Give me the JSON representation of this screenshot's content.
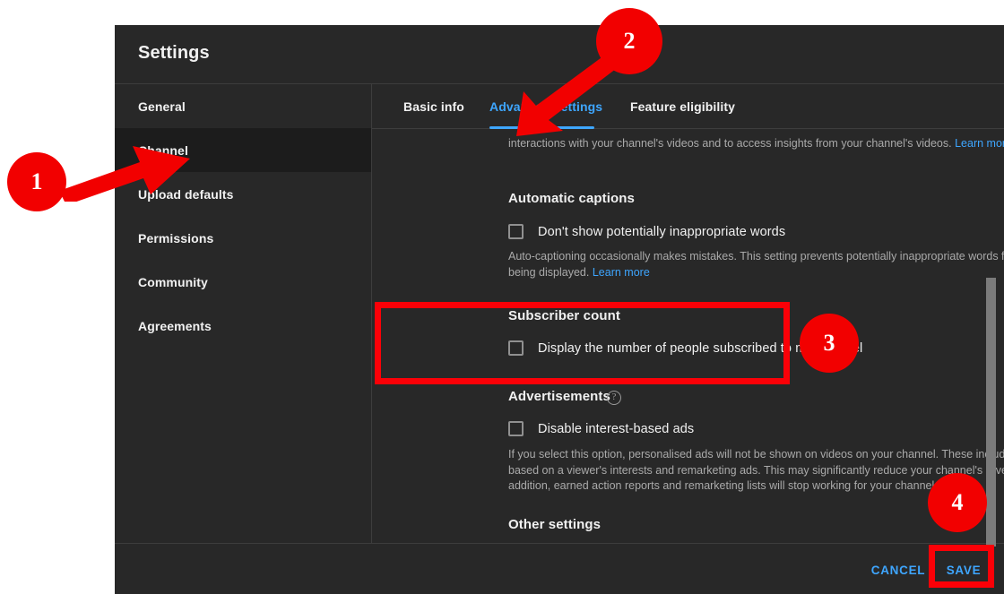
{
  "dialog": {
    "title": "Settings"
  },
  "sidebar": {
    "items": [
      {
        "label": "General",
        "active": false
      },
      {
        "label": "Channel",
        "active": true
      },
      {
        "label": "Upload defaults",
        "active": false
      },
      {
        "label": "Permissions",
        "active": false
      },
      {
        "label": "Community",
        "active": false
      },
      {
        "label": "Agreements",
        "active": false
      }
    ]
  },
  "tabs": [
    {
      "label": "Basic info",
      "active": false
    },
    {
      "label": "Advanced settings",
      "active": true
    },
    {
      "label": "Feature eligibility",
      "active": false
    }
  ],
  "content": {
    "clipped_paragraph": "interactions with your channel's videos and to access insights from your channel's videos.",
    "clipped_paragraph_link": "Learn more",
    "sections": [
      {
        "title": "Automatic captions",
        "checkbox_label": "Don't show potentially inappropriate words",
        "checked": false,
        "helper": "Auto-captioning occasionally makes mistakes. This setting prevents potentially inappropriate words from being displayed.",
        "helper_link": "Learn more"
      },
      {
        "title": "Subscriber count",
        "checkbox_label": "Display the number of people subscribed to my channel",
        "checked": false,
        "helper": "",
        "helper_link": ""
      },
      {
        "title": "Advertisements",
        "help_icon": "question-mark-circle-icon",
        "checkbox_label": "Disable interest-based ads",
        "checked": false,
        "helper": "If you select this option, personalised ads will not be shown on videos on your channel. These include ads based on a viewer's interests and remarketing ads. This may significantly reduce your channel's revenue. In addition, earned action reports and remarketing lists will stop working for your channel.",
        "helper_link": ""
      },
      {
        "title": "Other settings",
        "checkbox_label": "",
        "checked": false,
        "helper": "",
        "helper_link": ""
      }
    ]
  },
  "footer": {
    "cancel_label": "CANCEL",
    "save_label": "SAVE"
  },
  "annotations": {
    "badges": [
      {
        "number": "1"
      },
      {
        "number": "2"
      },
      {
        "number": "3"
      },
      {
        "number": "4"
      }
    ],
    "accent_color": "#f20000",
    "highlight_color": "#fb0007"
  },
  "colors": {
    "dialog_background": "#282828",
    "active_nav_background": "#1c1c1c",
    "link_blue": "#3ea6ff",
    "primary_text": "#f1f1f1",
    "secondary_text": "#aaaaaa"
  }
}
